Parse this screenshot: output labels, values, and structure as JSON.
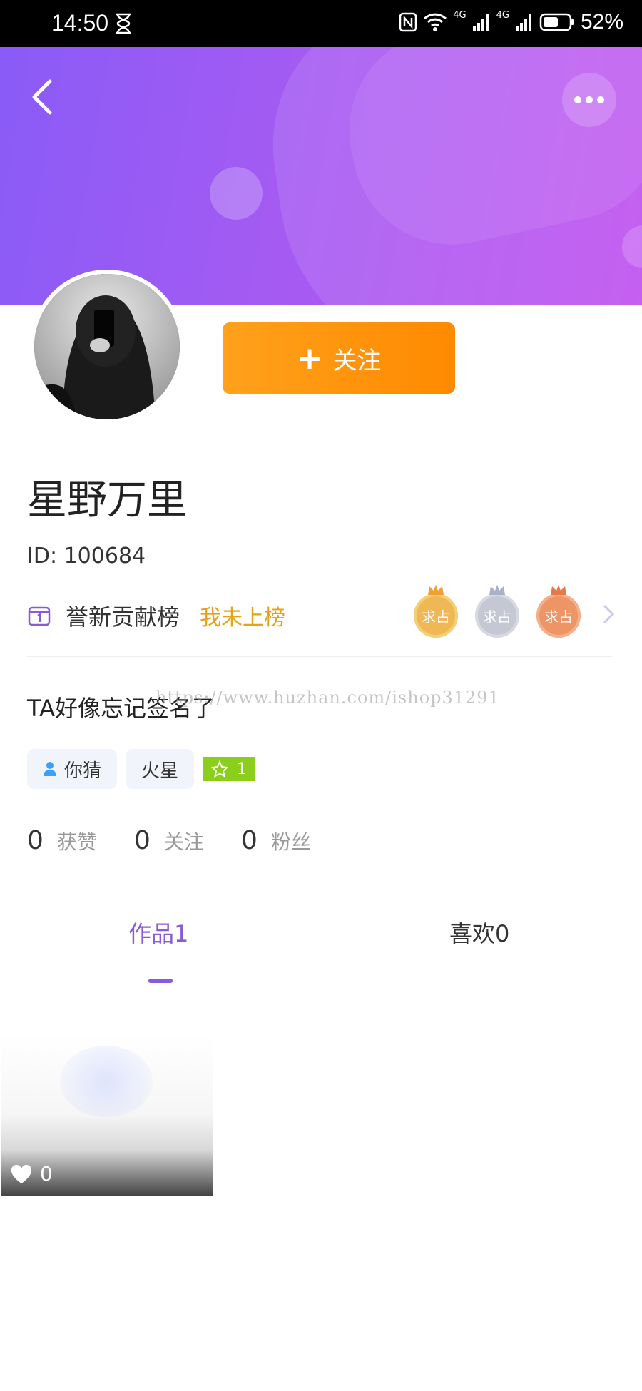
{
  "status_bar": {
    "time": "14:50",
    "network_1": "4G",
    "network_2": "4G",
    "battery": "52%"
  },
  "header": {
    "gradient_start": "#8a5bf7",
    "gradient_end": "#bf4ff0"
  },
  "profile": {
    "follow_label": "关注",
    "name": "星野万里",
    "id_text": "ID:  100684",
    "signature": "TA好像忘记签名了",
    "watermark": "https://www.huzhan.com/ishop31291"
  },
  "ranking": {
    "title": "誉新贡献榜",
    "status": "我未上榜",
    "medals": [
      {
        "label": "求占",
        "color": "#f0b755",
        "ring": "#f5cf78"
      },
      {
        "label": "求占",
        "color": "#c5c7d3",
        "ring": "#d7d9e2"
      },
      {
        "label": "求占",
        "color": "#ee9566",
        "ring": "#f3b08a"
      }
    ]
  },
  "tags": {
    "gender_tag": "你猜",
    "zodiac_tag": "火星",
    "level_value": "1"
  },
  "stats": [
    {
      "value": "0",
      "label": "获赞"
    },
    {
      "value": "0",
      "label": "关注"
    },
    {
      "value": "0",
      "label": "粉丝"
    }
  ],
  "tabs": {
    "works": "作品1",
    "likes": "喜欢0"
  },
  "works": [
    {
      "likes": "0"
    }
  ],
  "colors": {
    "accent": "#8a5bd8",
    "follow": "#ff9410",
    "rank_status": "#e6a21a",
    "level_badge": "#8ccf1a"
  }
}
